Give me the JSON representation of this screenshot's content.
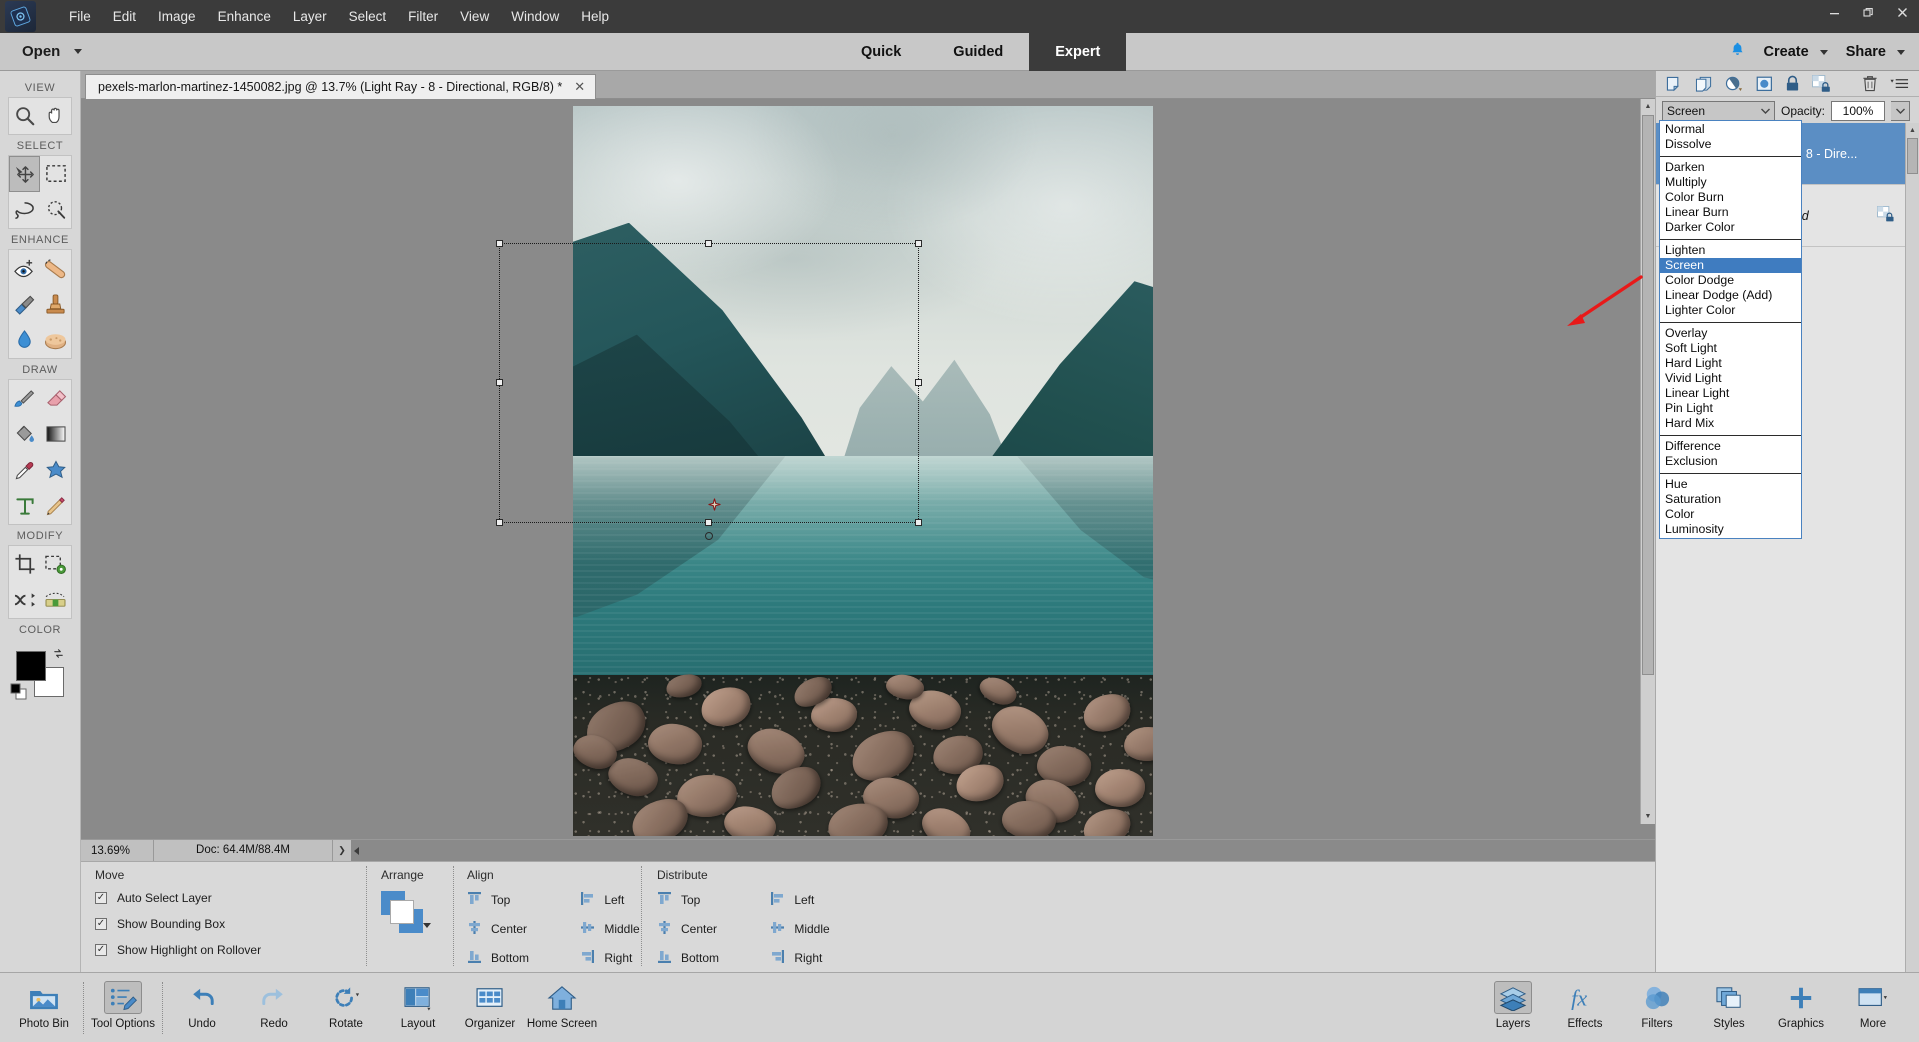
{
  "window": {
    "minimize": "—",
    "restore": "❐",
    "close": "✕"
  },
  "menubar": {
    "logo_name": "photoshop-elements-logo",
    "items": [
      "File",
      "Edit",
      "Image",
      "Enhance",
      "Layer",
      "Select",
      "Filter",
      "View",
      "Window",
      "Help"
    ]
  },
  "topbar": {
    "open_label": "Open",
    "modes": [
      {
        "label": "Quick",
        "active": false
      },
      {
        "label": "Guided",
        "active": false
      },
      {
        "label": "Expert",
        "active": true
      }
    ],
    "notification_icon": "bell-icon",
    "create_label": "Create",
    "share_label": "Share"
  },
  "toolbar": {
    "groups": [
      {
        "label": "VIEW",
        "tools": [
          {
            "name": "zoom-tool",
            "icon": "magnifier-icon",
            "active": false
          },
          {
            "name": "hand-tool",
            "icon": "hand-icon",
            "active": false
          }
        ]
      },
      {
        "label": "SELECT",
        "tools": [
          {
            "name": "move-tool",
            "icon": "move-arrows-icon",
            "active": true
          },
          {
            "name": "rectangular-marquee-tool",
            "icon": "marquee-icon",
            "active": false
          },
          {
            "name": "lasso-tool",
            "icon": "lasso-icon",
            "active": false
          },
          {
            "name": "quick-selection-tool",
            "icon": "quick-select-icon",
            "active": false
          }
        ]
      },
      {
        "label": "ENHANCE",
        "tools": [
          {
            "name": "red-eye-removal-tool",
            "icon": "eye-plus-icon",
            "active": false
          },
          {
            "name": "spot-healing-brush-tool",
            "icon": "healing-bandage-icon",
            "active": false
          },
          {
            "name": "smart-brush-tool",
            "icon": "smart-brush-icon",
            "active": false
          },
          {
            "name": "clone-stamp-tool",
            "icon": "stamp-icon",
            "active": false
          },
          {
            "name": "blur-tool",
            "icon": "waterdrop-icon",
            "active": false
          },
          {
            "name": "sponge-tool",
            "icon": "sponge-icon",
            "active": false
          }
        ]
      },
      {
        "label": "DRAW",
        "tools": [
          {
            "name": "brush-tool",
            "icon": "paintbrush-icon",
            "active": false
          },
          {
            "name": "eraser-tool",
            "icon": "eraser-icon",
            "active": false
          },
          {
            "name": "paint-bucket-tool",
            "icon": "paint-bucket-icon",
            "active": false
          },
          {
            "name": "gradient-tool",
            "icon": "gradient-icon",
            "active": false
          },
          {
            "name": "color-picker-tool",
            "icon": "eyedropper-icon",
            "active": false
          },
          {
            "name": "custom-shape-tool",
            "icon": "star-shape-icon",
            "active": false
          },
          {
            "name": "type-tool",
            "icon": "type-t-icon",
            "active": false
          },
          {
            "name": "pencil-tool",
            "icon": "pencil-icon",
            "active": false
          }
        ]
      },
      {
        "label": "MODIFY",
        "tools": [
          {
            "name": "crop-tool",
            "icon": "crop-icon",
            "active": false
          },
          {
            "name": "recompose-tool",
            "icon": "recompose-icon",
            "active": false
          },
          {
            "name": "content-aware-move-tool",
            "icon": "content-move-icon",
            "active": false
          },
          {
            "name": "straighten-tool",
            "icon": "straighten-icon",
            "active": false
          }
        ]
      }
    ],
    "color_label": "COLOR",
    "foreground_color": "#000000",
    "background_color": "#ffffff"
  },
  "document": {
    "tab_title": "pexels-marlon-martinez-1450082.jpg @ 13.7% (Light Ray - 8 - Directional, RGB/8) *",
    "close_glyph": "✕"
  },
  "statusbar": {
    "zoom": "13.69%",
    "doc_size": "Doc: 64.4M/88.4M",
    "expand_glyph": "❯"
  },
  "tool_options": {
    "move_title": "Move",
    "checkboxes": [
      {
        "label": "Auto Select Layer",
        "checked": true
      },
      {
        "label": "Show Bounding Box",
        "checked": true
      },
      {
        "label": "Show Highlight on Rollover",
        "checked": true
      }
    ],
    "arrange_title": "Arrange",
    "align_title": "Align",
    "align_items": [
      "Top",
      "Left",
      "Center",
      "Middle",
      "Bottom",
      "Right"
    ],
    "distribute_title": "Distribute",
    "distribute_items": [
      "Top",
      "Left",
      "Center",
      "Middle",
      "Bottom",
      "Right"
    ],
    "help_glyph": "?"
  },
  "layers_panel": {
    "icons": [
      {
        "name": "new-layer-icon"
      },
      {
        "name": "duplicate-layer-icon"
      },
      {
        "name": "adjustment-layer-icon"
      },
      {
        "name": "layer-mask-icon"
      },
      {
        "name": "lock-all-icon"
      },
      {
        "name": "lock-transparency-icon"
      },
      {
        "name": "delete-layer-icon"
      },
      {
        "name": "panel-menu-icon"
      }
    ],
    "blend_mode": "Screen",
    "opacity_label": "Opacity:",
    "opacity_value": "100%",
    "layers": [
      {
        "name": "Light Ray - 8 - Dire...",
        "selected": true,
        "italic": false,
        "locked": false
      },
      {
        "name": "Background",
        "selected": false,
        "italic": true,
        "locked": true
      }
    ]
  },
  "blend_menu": {
    "selected": "Screen",
    "groups": [
      [
        "Normal",
        "Dissolve"
      ],
      [
        "Darken",
        "Multiply",
        "Color Burn",
        "Linear Burn",
        "Darker Color"
      ],
      [
        "Lighten",
        "Screen",
        "Color Dodge",
        "Linear Dodge (Add)",
        "Lighter Color"
      ],
      [
        "Overlay",
        "Soft Light",
        "Hard Light",
        "Vivid Light",
        "Linear Light",
        "Pin Light",
        "Hard Mix"
      ],
      [
        "Difference",
        "Exclusion"
      ],
      [
        "Hue",
        "Saturation",
        "Color",
        "Luminosity"
      ]
    ]
  },
  "annotation": {
    "arrow_color": "#e81919",
    "arrow_name": "red-pointer-arrow"
  },
  "taskbar": {
    "left": [
      {
        "label": "Photo Bin",
        "icon": "photo-bin-icon",
        "active": false
      },
      {
        "label": "Tool Options",
        "icon": "tool-options-icon",
        "active": true
      },
      {
        "label": "Undo",
        "icon": "undo-arrow-icon",
        "active": false
      },
      {
        "label": "Redo",
        "icon": "redo-arrow-icon",
        "active": false
      },
      {
        "label": "Rotate",
        "icon": "rotate-icon",
        "active": false
      },
      {
        "label": "Layout",
        "icon": "layout-grid-icon",
        "active": false
      },
      {
        "label": "Organizer",
        "icon": "organizer-grid-icon",
        "active": false
      },
      {
        "label": "Home Screen",
        "icon": "home-icon",
        "active": false
      }
    ],
    "right": [
      {
        "label": "Layers",
        "icon": "layers-stack-icon",
        "active": true
      },
      {
        "label": "Effects",
        "icon": "fx-icon",
        "active": false
      },
      {
        "label": "Filters",
        "icon": "filters-circles-icon",
        "active": false
      },
      {
        "label": "Styles",
        "icon": "styles-squares-icon",
        "active": false
      },
      {
        "label": "Graphics",
        "icon": "plus-icon",
        "active": false
      },
      {
        "label": "More",
        "icon": "more-panel-icon",
        "active": false
      }
    ]
  }
}
